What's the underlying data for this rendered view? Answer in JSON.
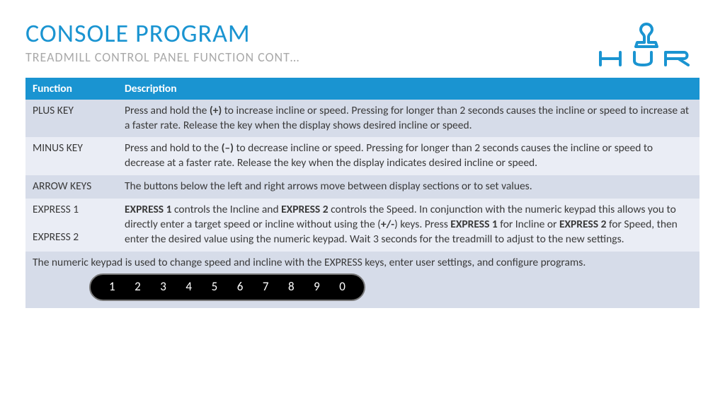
{
  "header": {
    "title": "CONSOLE PROGRAM",
    "subtitle": "TREADMILL CONTROL PANEL FUNCTION CONT…",
    "logo_text": "HUR"
  },
  "table": {
    "headers": [
      "Function",
      "Description"
    ],
    "rows": [
      {
        "func": "PLUS KEY",
        "desc_pre": "Press and hold the ",
        "desc_bold1": "(+)",
        "desc_post": " to increase incline or speed. Pressing for longer than 2 seconds causes the incline or speed to increase at a faster rate. Release the key when the display shows desired incline or speed."
      },
      {
        "func": "MINUS KEY",
        "desc_pre": "Press and hold to the ",
        "desc_bold1": "(–)",
        "desc_post": " to decrease incline or speed. Pressing for longer than 2 seconds causes the incline or speed to decrease at a faster rate. Release the key when the display indicates desired incline or speed."
      },
      {
        "func": "ARROW KEYS",
        "desc_plain": "The buttons below the left and right arrows move between display sections or to set values."
      },
      {
        "func1": "EXPRESS 1",
        "func2": "EXPRESS 2",
        "p1_a": "EXPRESS 1",
        "p1_b": " controls the Incline and ",
        "p1_c": "EXPRESS 2",
        "p1_d": " controls the Speed. In conjunction with the numeric keypad this allows you to directly enter a target speed or incline without using the (",
        "p1_e": "+/-",
        "p1_f": ") keys. Press ",
        "p1_g": "EXPRESS 1",
        "p1_h": " for Incline or ",
        "p1_i": "EXPRESS 2",
        "p1_j": " for Speed, then enter the desired value using the numeric keypad. Wait 3 seconds for the treadmill to adjust to the new settings."
      }
    ],
    "footer_text": "The numeric keypad is used to change speed and incline with the EXPRESS keys, enter user settings, and configure programs.",
    "keypad": [
      "1",
      "2",
      "3",
      "4",
      "5",
      "6",
      "7",
      "8",
      "9",
      "0"
    ]
  }
}
